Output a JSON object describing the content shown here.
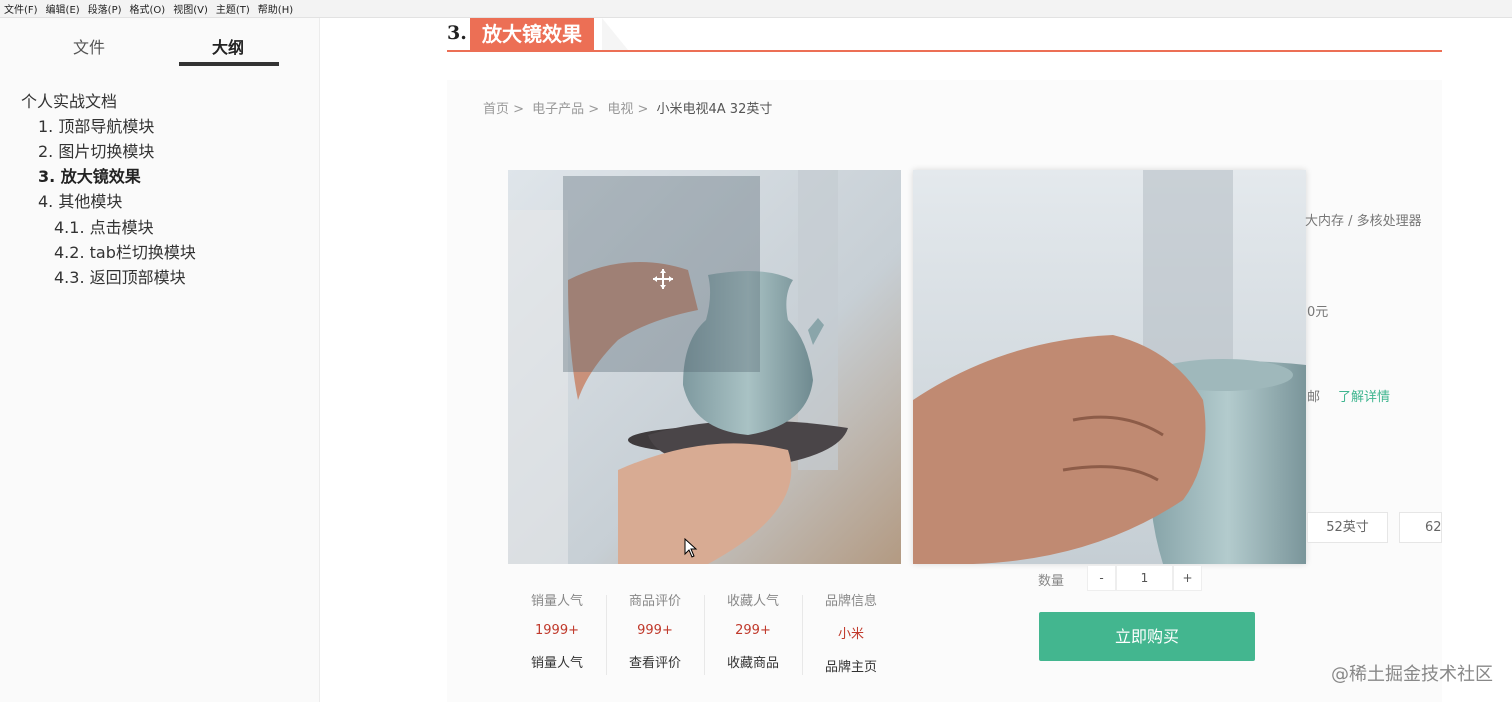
{
  "menu": [
    "文件(F)",
    "编辑(E)",
    "段落(P)",
    "格式(O)",
    "视图(V)",
    "主题(T)",
    "帮助(H)"
  ],
  "sidebar": {
    "tabs": [
      "文件",
      "大纲"
    ],
    "outline": [
      {
        "label": "个人实战文档",
        "active": false
      },
      {
        "label": "1. 顶部导航模块",
        "active": false
      },
      {
        "label": "2. 图片切换模块",
        "active": false
      },
      {
        "label": "3. 放大镜效果",
        "active": true
      },
      {
        "label": "4. 其他模块",
        "active": false
      },
      {
        "label": "4.1. 点击模块",
        "active": false
      },
      {
        "label": "4.2. tab栏切换模块",
        "active": false
      },
      {
        "label": "4.3. 返回顶部模块",
        "active": false
      }
    ]
  },
  "heading": {
    "number": "3.",
    "title": "放大镜效果"
  },
  "breadcrumb": [
    "首页 >",
    "电子产品 >",
    "电视 >",
    "小米电视4A 32英寸"
  ],
  "product": {
    "spec_fragment": "大内存 / 多核处理器",
    "price_fragment": "0元",
    "service_fragment": "邮",
    "more_link": "了解详情",
    "sizes": [
      "52英寸",
      "62"
    ],
    "quantity_label": "数量",
    "quantity": {
      "minus": "-",
      "value": "1",
      "plus": "+"
    },
    "buy_label": "立即购买"
  },
  "stats": [
    {
      "title": "销量人气",
      "value": "1999+",
      "action": "销量人气"
    },
    {
      "title": "商品评价",
      "value": "999+",
      "action": "查看评价"
    },
    {
      "title": "收藏人气",
      "value": "299+",
      "action": "收藏商品"
    },
    {
      "title": "品牌信息",
      "value": "小米",
      "action": "品牌主页"
    }
  ],
  "watermark": "@稀土掘金技术社区",
  "colors": {
    "accent": "#ec6f55",
    "buy": "#43b68f",
    "price": "#c0392b"
  }
}
